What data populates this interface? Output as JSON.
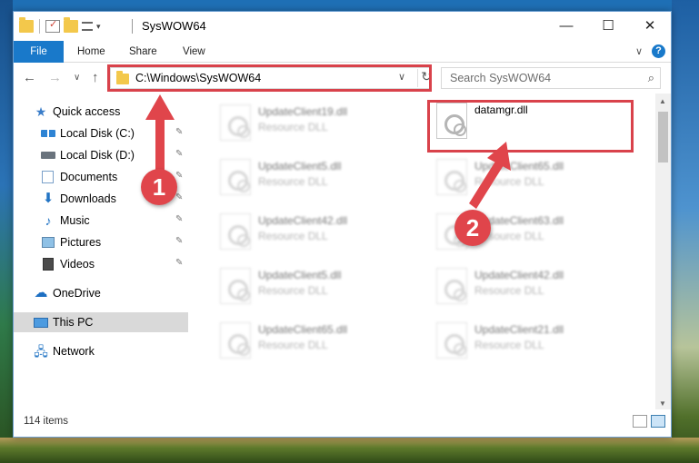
{
  "window": {
    "title": "SysWOW64",
    "controls": {
      "minimize": "—",
      "maximize": "☐",
      "close": "✕"
    }
  },
  "ribbon": {
    "tabs": [
      "File",
      "Home",
      "Share",
      "View"
    ],
    "expand": "∨",
    "help": "?"
  },
  "nav": {
    "back": "←",
    "forward": "→",
    "recent": "∨",
    "up": "↑",
    "address": "C:\\Windows\\SysWOW64",
    "address_drop": "∨",
    "refresh": "↻",
    "search_placeholder": "Search SysWOW64",
    "search_icon": "⌕"
  },
  "sidebar": {
    "items": [
      {
        "label": "Quick access",
        "icon": "star-icon",
        "pinned": false
      },
      {
        "label": "Local Disk (C:)",
        "icon": "windows-drive-icon",
        "pinned": true
      },
      {
        "label": "Local Disk (D:)",
        "icon": "drive-icon",
        "pinned": true
      },
      {
        "label": "Documents",
        "icon": "documents-icon",
        "pinned": true
      },
      {
        "label": "Downloads",
        "icon": "downloads-icon",
        "pinned": true
      },
      {
        "label": "Music",
        "icon": "music-icon",
        "pinned": true
      },
      {
        "label": "Pictures",
        "icon": "pictures-icon",
        "pinned": true
      },
      {
        "label": "Videos",
        "icon": "videos-icon",
        "pinned": true
      },
      {
        "label": "OneDrive",
        "icon": "onedrive-icon",
        "pinned": false
      },
      {
        "label": "This PC",
        "icon": "this-pc-icon",
        "pinned": false,
        "selected": true
      },
      {
        "label": "Network",
        "icon": "network-icon",
        "pinned": false
      }
    ],
    "pin_glyph": "📌"
  },
  "files": [
    {
      "name": "UpdateClient19.dll",
      "type": "Resource DLL"
    },
    {
      "name": "datamgr.dll",
      "type": ""
    },
    {
      "name": "UpdateClient5.dll",
      "type": "Resource DLL"
    },
    {
      "name": "UpdateClient65.dll",
      "type": "Resource DLL"
    },
    {
      "name": "UpdateClient42.dll",
      "type": "Resource DLL"
    },
    {
      "name": "UpdateClient63.dll",
      "type": "Resource DLL"
    },
    {
      "name": "UpdateClient5.dll",
      "type": "Resource DLL"
    },
    {
      "name": "UpdateClient42.dll",
      "type": "Resource DLL"
    },
    {
      "name": "UpdateClient65.dll",
      "type": "Resource DLL"
    },
    {
      "name": "UpdateClient21.dll",
      "type": "Resource DLL"
    }
  ],
  "status": {
    "item_count": "114 items"
  },
  "annotations": {
    "step1": "1",
    "step2": "2",
    "color": "#e0454b"
  }
}
